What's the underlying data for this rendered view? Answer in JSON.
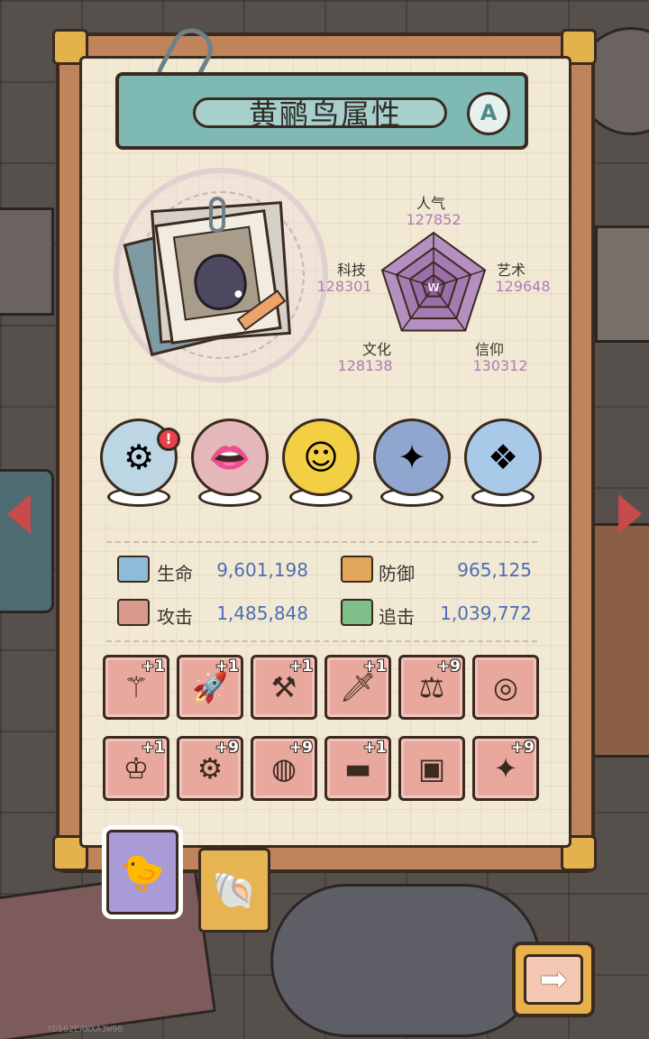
{
  "title": "黄鹂鸟属性",
  "grade": "A",
  "radar": {
    "stats": [
      {
        "name": "人气",
        "value": "127852"
      },
      {
        "name": "艺术",
        "value": "129648"
      },
      {
        "name": "信仰",
        "value": "130312"
      },
      {
        "name": "文化",
        "value": "128138"
      },
      {
        "name": "科技",
        "value": "128301"
      }
    ],
    "center_mark": "W"
  },
  "skills": [
    {
      "icon": "mech-arm-icon",
      "glyph": "⚙",
      "color": "#bcd6e3",
      "alert": "!"
    },
    {
      "icon": "monster-mouth-icon",
      "glyph": "👄",
      "color": "#e4b8b9"
    },
    {
      "icon": "smile-face-icon",
      "glyph": "☺",
      "color": "#f3d043"
    },
    {
      "icon": "compass-icon",
      "glyph": "✦",
      "color": "#8fa7cf"
    },
    {
      "icon": "cube-gem-icon",
      "glyph": "❖",
      "color": "#a9c9e9"
    }
  ],
  "attributes": {
    "hp": {
      "label": "生命",
      "value": "9,601,198"
    },
    "defense": {
      "label": "防御",
      "value": "965,125"
    },
    "attack": {
      "label": "攻击",
      "value": "1,485,848"
    },
    "chase": {
      "label": "追击",
      "value": "1,039,772"
    }
  },
  "equipment": [
    {
      "icon": "serpent-staff-icon",
      "glyph": "⚚",
      "plus": "+1"
    },
    {
      "icon": "rocket-icon",
      "glyph": "🚀",
      "plus": "+1"
    },
    {
      "icon": "hammer-icon",
      "glyph": "⚒",
      "plus": "+1"
    },
    {
      "icon": "sword-icon",
      "glyph": "🗡",
      "plus": "+1"
    },
    {
      "icon": "scale-icon",
      "glyph": "⚖",
      "plus": "+9"
    },
    {
      "icon": "ring-orb-icon",
      "glyph": "◎",
      "plus": ""
    },
    {
      "icon": "crown-icon",
      "glyph": "♔",
      "plus": "+1"
    },
    {
      "icon": "gear-amulet-icon",
      "glyph": "⚙",
      "plus": "+9"
    },
    {
      "icon": "bracelet-icon",
      "glyph": "◍",
      "plus": "+9"
    },
    {
      "icon": "belt-icon",
      "glyph": "▬",
      "plus": "+1"
    },
    {
      "icon": "device-box-icon",
      "glyph": "▣",
      "plus": ""
    },
    {
      "icon": "dagger-icon",
      "glyph": "✦",
      "plus": "+9"
    }
  ],
  "tabs": [
    {
      "icon": "chick-icon",
      "glyph": "🐤",
      "active": true
    },
    {
      "icon": "horn-icon",
      "glyph": "🐚",
      "active": false
    }
  ],
  "next_button_glyph": "➡",
  "footer_code": "YD562EAWXA3W90",
  "colors": {
    "accent": "#7fb9b4",
    "value_blue": "#4a6fb4",
    "radar_purple": "#b17bb7",
    "equip_bg": "#e8a89e"
  }
}
